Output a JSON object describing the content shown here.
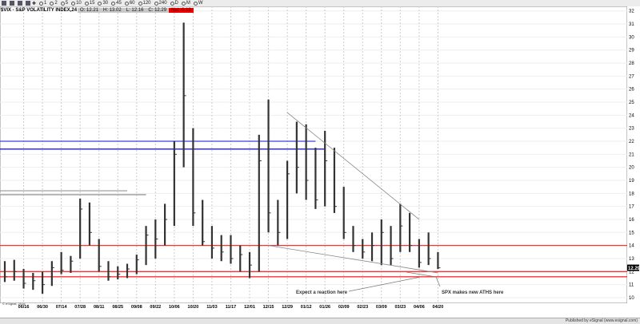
{
  "toolbar": {
    "buttons": [
      "1",
      "2",
      "5",
      "10",
      "15",
      "30",
      "45",
      "60",
      "120",
      "240",
      "D",
      "M",
      "W"
    ]
  },
  "legend": {
    "symbol": "$VIX - S&P VOLATILITY INDEX,24",
    "open": "O: 12.21",
    "high": "H: 13.02",
    "low": "L: 12.16",
    "close": "C: 12.29",
    "net": "Net -0.18",
    "net_color": "#e00000"
  },
  "copyright": "© eSignal, 2015",
  "status": "Published by eSignal (www.esignal.com)",
  "last_price_label": "12.29",
  "chart_data": {
    "type": "ohlc",
    "title": "$VIX - S&P VOLATILITY INDEX",
    "ylim": [
      9.5,
      32
    ],
    "yticks": [
      10,
      11,
      12,
      13,
      14,
      15,
      16,
      17,
      18,
      19,
      20,
      21,
      22,
      23,
      24,
      25,
      26,
      27,
      28,
      29,
      30,
      31,
      32
    ],
    "xtick_labels": [
      "06/16",
      "06/30",
      "07/14",
      "07/28",
      "08/11",
      "08/25",
      "09/08",
      "09/22",
      "10/06",
      "10/20",
      "11/03",
      "11/17",
      "12/01",
      "12/15",
      "12/29",
      "01/12",
      "01/26",
      "02/09",
      "02/23",
      "03/09",
      "03/23",
      "04/06",
      "04/20"
    ],
    "grid": true,
    "bars": {
      "dates": [
        "06/02",
        "06/09",
        "06/16",
        "06/23",
        "06/30",
        "07/07",
        "07/14",
        "07/21",
        "07/28",
        "08/04",
        "08/11",
        "08/18",
        "08/25",
        "09/01",
        "09/08",
        "09/15",
        "09/22",
        "09/29",
        "10/06",
        "10/13",
        "10/20",
        "10/27",
        "11/03",
        "11/10",
        "11/17",
        "11/24",
        "12/01",
        "12/08",
        "12/15",
        "12/22",
        "12/29",
        "01/05",
        "01/12",
        "01/19",
        "01/26",
        "02/02",
        "02/09",
        "02/16",
        "02/23",
        "03/02",
        "03/09",
        "03/16",
        "03/23",
        "03/30",
        "04/06",
        "04/13",
        "04/20"
      ],
      "high": [
        12.8,
        12.9,
        12.2,
        11.9,
        12.0,
        12.8,
        13.5,
        13.2,
        17.6,
        17.3,
        14.5,
        12.8,
        12.4,
        12.6,
        13.3,
        15.5,
        16.0,
        17.2,
        22.0,
        31.1,
        23.0,
        17.5,
        15.5,
        14.8,
        14.8,
        14.0,
        13.5,
        22.5,
        25.2,
        17.5,
        20.5,
        23.5,
        23.3,
        21.5,
        22.8,
        21.5,
        18.5,
        15.5,
        14.5,
        15.0,
        16.0,
        15.5,
        17.2,
        16.5,
        14.5,
        15.0,
        13.5
      ],
      "low": [
        11.2,
        11.3,
        10.7,
        10.6,
        10.3,
        10.9,
        11.8,
        11.9,
        13.0,
        14.0,
        12.0,
        11.3,
        11.4,
        11.5,
        11.8,
        12.5,
        13.0,
        14.0,
        15.5,
        20.0,
        15.5,
        14.0,
        13.0,
        12.8,
        12.6,
        12.0,
        11.5,
        12.0,
        15.0,
        14.0,
        14.5,
        18.0,
        17.5,
        16.8,
        17.0,
        16.5,
        14.5,
        13.5,
        13.0,
        12.8,
        12.5,
        12.5,
        13.5,
        13.5,
        12.3,
        12.5,
        12.2
      ],
      "close": [
        11.6,
        12.0,
        11.1,
        11.3,
        11.0,
        12.3,
        12.1,
        12.8,
        16.8,
        15.0,
        12.4,
        11.6,
        11.8,
        12.2,
        12.9,
        14.8,
        14.5,
        16.0,
        21.0,
        25.5,
        16.5,
        14.3,
        13.8,
        13.5,
        13.0,
        13.3,
        12.5,
        20.5,
        16.5,
        15.0,
        19.5,
        20.0,
        19.0,
        17.5,
        20.5,
        17.0,
        15.0,
        14.0,
        13.5,
        14.0,
        15.0,
        13.0,
        15.5,
        14.0,
        12.7,
        13.0,
        12.29
      ]
    },
    "horizontal_lines": [
      {
        "value": 14.0,
        "color": "#ff3030",
        "from": "06/02",
        "to": "end"
      },
      {
        "value": 12.0,
        "color": "#ff3030",
        "from": "06/02",
        "to": "end"
      },
      {
        "value": 11.6,
        "color": "#ff3030",
        "from": "06/02",
        "to": "end"
      },
      {
        "value": 22.0,
        "color": "#4040e0",
        "from": "06/02",
        "to": "01/19"
      },
      {
        "value": 21.4,
        "color": "#2020c0",
        "from": "06/02",
        "to": "01/26"
      },
      {
        "value": 18.2,
        "color": "#aaaaaa",
        "from": "06/02",
        "to": "09/01"
      },
      {
        "value": 17.9,
        "color": "#999999",
        "from": "06/02",
        "to": "09/15"
      }
    ],
    "trendlines": [
      {
        "from": [
          "12/29",
          24.2
        ],
        "to": [
          "04/06",
          16.0
        ],
        "color": "#888888"
      },
      {
        "from": [
          "12/15",
          14.0
        ],
        "to": [
          "04/20",
          11.9
        ],
        "color": "#888888"
      }
    ],
    "annotations": [
      "Expect a reaction here",
      "SPX makes new ATHS here"
    ]
  }
}
